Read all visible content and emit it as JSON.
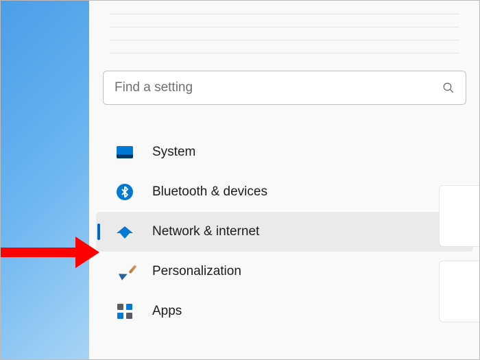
{
  "search": {
    "placeholder": "Find a setting"
  },
  "nav": {
    "items": [
      {
        "label": "System",
        "icon": "system-icon",
        "selected": false
      },
      {
        "label": "Bluetooth & devices",
        "icon": "bluetooth-icon",
        "selected": false
      },
      {
        "label": "Network & internet",
        "icon": "wifi-icon",
        "selected": true
      },
      {
        "label": "Personalization",
        "icon": "brush-icon",
        "selected": false
      },
      {
        "label": "Apps",
        "icon": "apps-icon",
        "selected": false
      }
    ]
  },
  "annotation": {
    "color": "#ff0000"
  }
}
